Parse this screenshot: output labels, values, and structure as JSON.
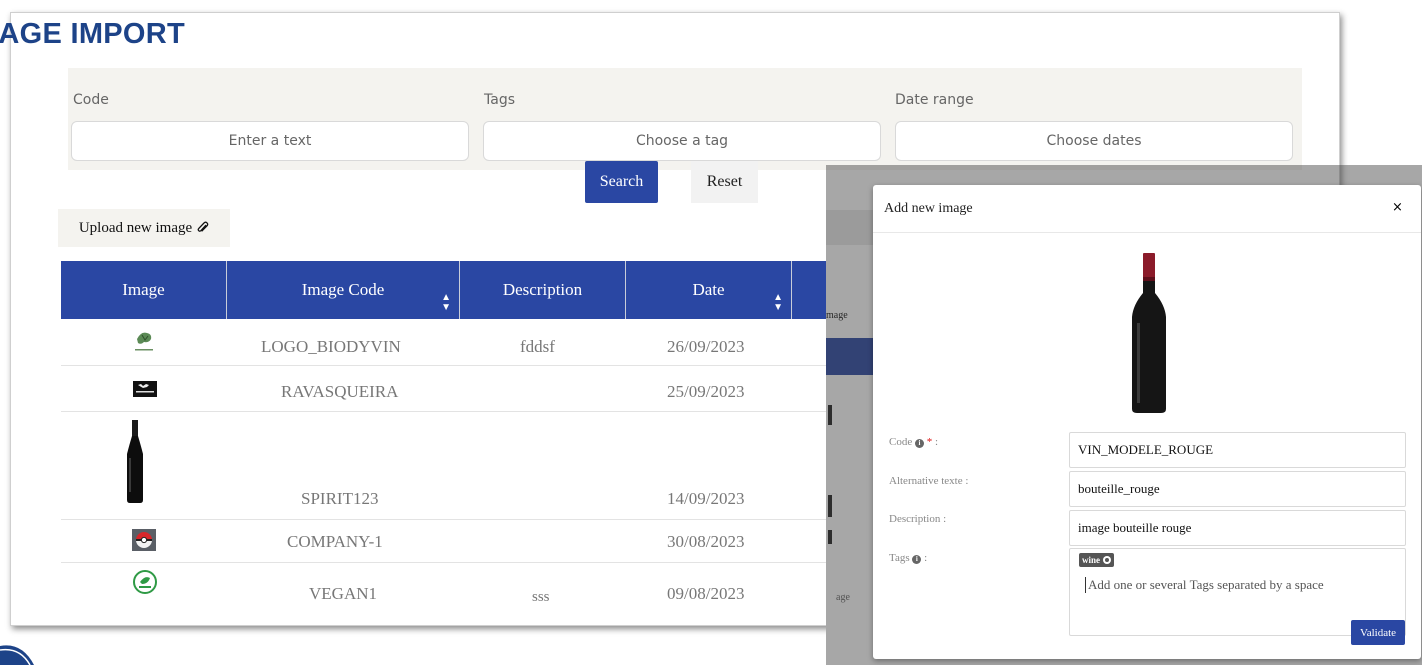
{
  "page": {
    "title": "IAGE IMPORT"
  },
  "filters": {
    "code": {
      "label": "Code",
      "placeholder": "Enter a text"
    },
    "tags": {
      "label": "Tags",
      "placeholder": "Choose a tag"
    },
    "date_range": {
      "label": "Date range",
      "placeholder": "Choose dates"
    }
  },
  "actions": {
    "search": "Search",
    "reset": "Reset",
    "upload": "Upload new image"
  },
  "table": {
    "headers": {
      "image": "Image",
      "image_code": "Image Code",
      "description": "Description",
      "date": "Date"
    },
    "rows": [
      {
        "thumb": "biodyvin-logo",
        "code": "LOGO_BIODYVIN",
        "description": "fddsf",
        "date": "26/09/2023"
      },
      {
        "thumb": "ravasqueira-logo",
        "code": "RAVASQUEIRA",
        "description": "",
        "date": "25/09/2023"
      },
      {
        "thumb": "spirit-bottle",
        "code": "SPIRIT123",
        "description": "",
        "date": "14/09/2023"
      },
      {
        "thumb": "pokeball",
        "code": "COMPANY-1",
        "description": "",
        "date": "30/08/2023"
      },
      {
        "thumb": "vegan-badge",
        "code": "VEGAN1",
        "description": "sss",
        "date": "09/08/2023"
      }
    ]
  },
  "behind_fragments": {
    "upload": "mage",
    "row": "age"
  },
  "modal": {
    "title": "Add new image",
    "close": "×",
    "preview": "red-wine-bottle",
    "fields": {
      "code": {
        "label": "Code",
        "required": "*",
        "suffix": ":",
        "value": "VIN_MODELE_ROUGE"
      },
      "alt": {
        "label": "Alternative texte :",
        "value": "bouteille_rouge"
      },
      "description": {
        "label": "Description :",
        "value": "image bouteille rouge"
      },
      "tags": {
        "label": "Tags",
        "suffix": ":",
        "chip": "wine",
        "placeholder": "Add one or several Tags separated by a space"
      }
    },
    "validate": "Validate"
  },
  "colors": {
    "primary": "#2a47a3",
    "title": "#1d4388",
    "panel": "#f4f3ef"
  }
}
